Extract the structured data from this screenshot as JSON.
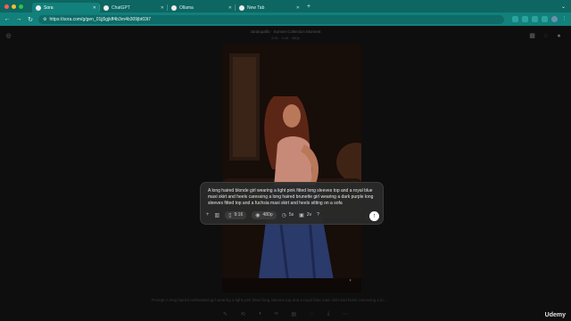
{
  "browser": {
    "tabs": [
      {
        "title": "Sora",
        "active": true
      },
      {
        "title": "ChatGPT",
        "active": false
      },
      {
        "title": "Ollama",
        "active": false
      },
      {
        "title": "New Tab",
        "active": false
      }
    ],
    "url": "https://sora.com/g/gen_01jj5gjkff4b3rn4b309jbt03t7",
    "traffic_colors": [
      "#ff5f57",
      "#febc2e",
      "#28c840"
    ]
  },
  "page": {
    "header_title": "zaralopalfo · Sonnet Collection Moment",
    "header_sub": "2:21 · 9:16 · 480p"
  },
  "composer": {
    "prompt": "A long haired blonde girl wearing a light pink fitted long sleeves top and a royal blue maxi skirt and heels caressing a long haired brunette girl wearing a dark purple long sleeves fitted top and a fuchsia maxi skirt and heels sitting on a sofa",
    "aspect_label": "9:16",
    "resolution_label": "480p",
    "duration_label": "5s",
    "variations_label": "2v",
    "help_label": "?"
  },
  "caption": "Prompt  A long haired redheaded girl wearing a light pink fitted long sleeves top and a royal blue maxi skirt and heels caressing a lo...",
  "branding": {
    "udemy": "Udemy"
  }
}
